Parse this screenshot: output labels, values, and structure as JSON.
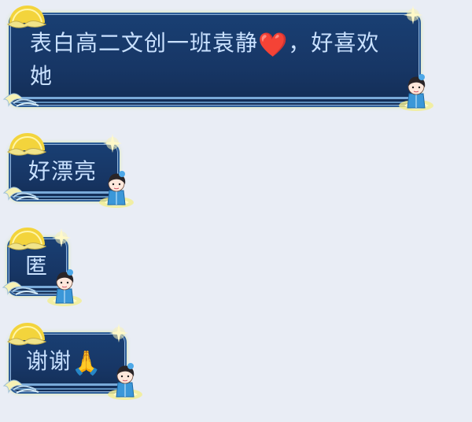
{
  "chat": {
    "messages": [
      {
        "text": "表白高二文创一班袁静",
        "emoji": "❤️",
        "text_after": "，好喜欢她"
      },
      {
        "text": "好漂亮"
      },
      {
        "text": "匿"
      },
      {
        "text": "谢谢",
        "emoji": "🙏"
      }
    ]
  },
  "icons": {
    "moon": "moon-icon",
    "sparkle": "sparkle-icon",
    "wave": "wave-icon",
    "avatar": "avatar-sticker"
  },
  "colors": {
    "background": "#e9edf5",
    "bubble": "#193f73",
    "bubble_border": "#2d5d98",
    "text": "#c9e1ff",
    "moon": "#f3d43c",
    "sparkle": "#f3ee96",
    "avatar_dress": "#3b97d8"
  }
}
